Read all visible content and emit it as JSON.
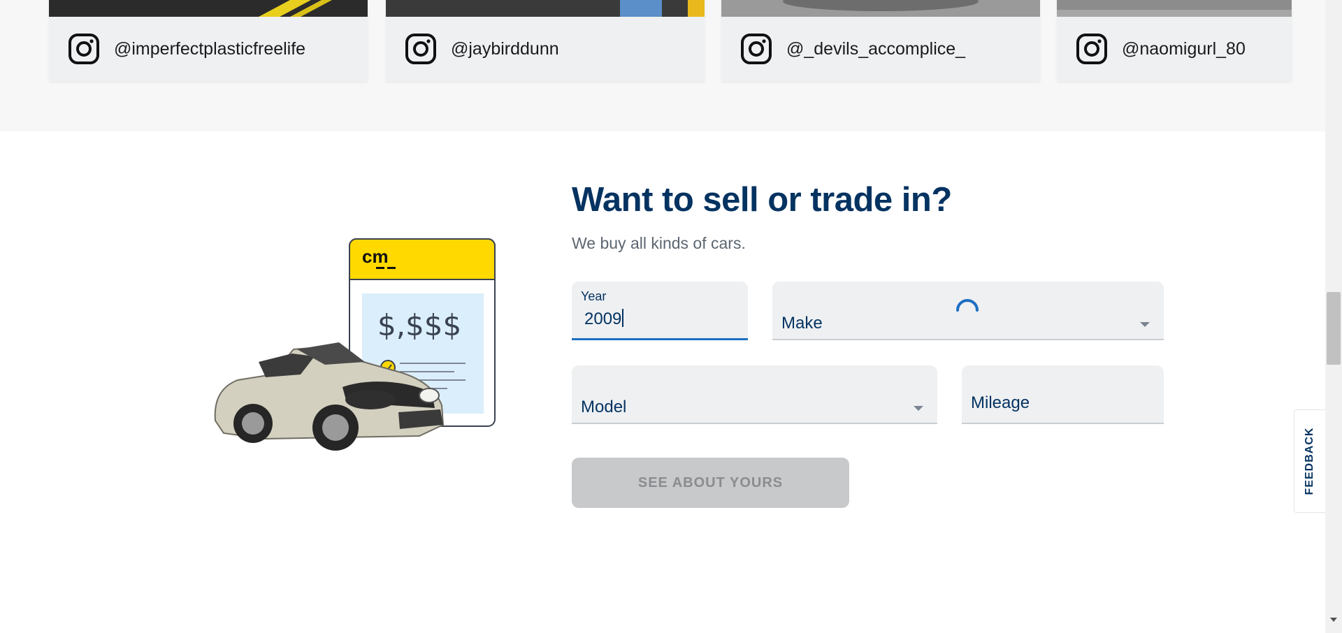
{
  "instagram": {
    "cards": [
      {
        "handle": "@imperfectplasticfreelife"
      },
      {
        "handle": "@jaybirddunn"
      },
      {
        "handle": "@_devils_accomplice_"
      },
      {
        "handle": "@naomigurl_80"
      }
    ],
    "icon": "instagram-icon"
  },
  "sell": {
    "title": "Want to sell or trade in?",
    "subtitle": "We buy all kinds of cars.",
    "illustration": {
      "logo": "cm",
      "price": "$,$$$"
    },
    "form": {
      "year": {
        "label": "Year",
        "value": "2009"
      },
      "make": {
        "placeholder": "Make",
        "loading": true
      },
      "model": {
        "placeholder": "Model"
      },
      "mileage": {
        "placeholder": "Mileage"
      },
      "submit_label": "SEE ABOUT YOURS"
    }
  },
  "feedback": {
    "label": "FEEDBACK"
  },
  "colors": {
    "brand_navy": "#053361",
    "accent_blue": "#1d6fc2",
    "logo_yellow": "#ffd900",
    "field_bg": "#eef0f2",
    "disabled_button": "#c8c9cb"
  }
}
